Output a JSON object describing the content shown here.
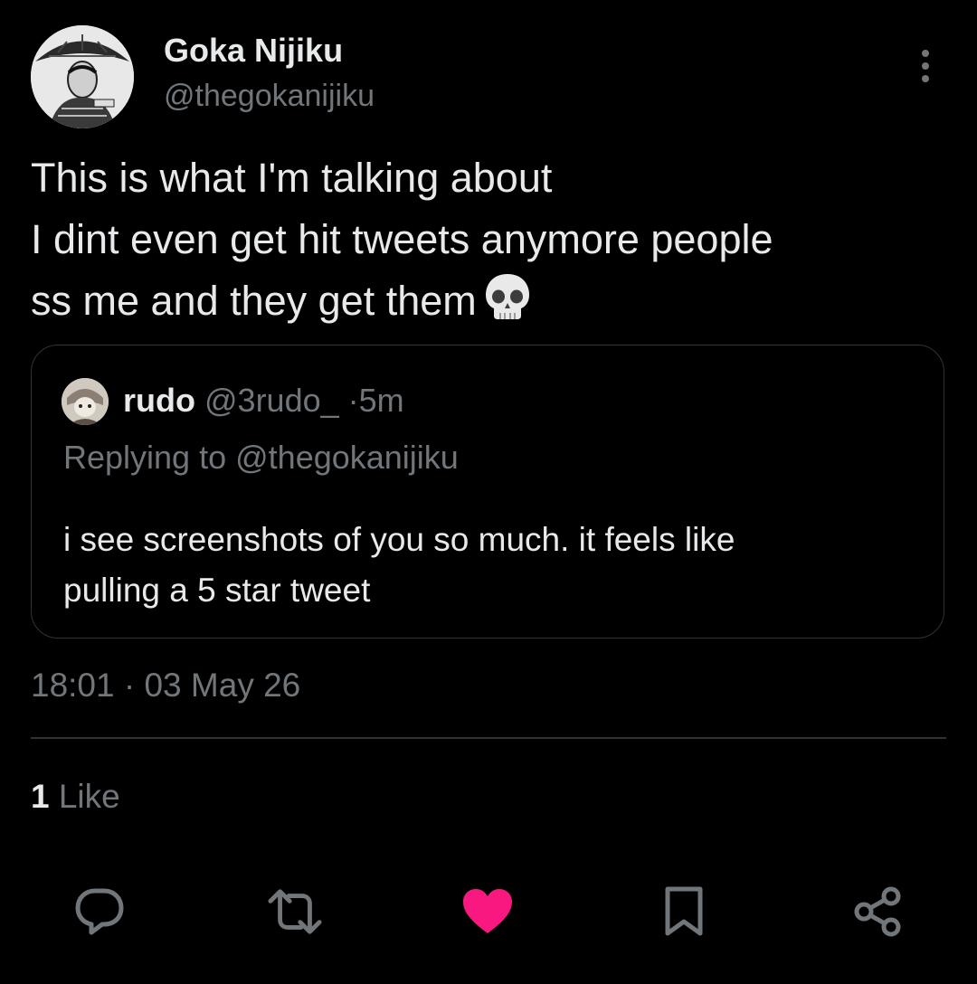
{
  "author": {
    "display_name": "Goka Nijiku",
    "handle": "@thegokanijiku",
    "avatar": "manga-character-avatar"
  },
  "tweet": {
    "text_lines": [
      "This is what I'm talking about",
      "I dint even get hit tweets anymore people",
      "ss me and they get them"
    ],
    "emoji": "skull-emoji"
  },
  "quote": {
    "display_name": "rudo",
    "handle": "@3rudo_",
    "separator": "·",
    "time": "5m",
    "replying_prefix": "Replying to",
    "replying_to": "@thegokanijiku",
    "text_lines": [
      "i see screenshots of you so much. it feels like",
      "pulling a 5 star tweet"
    ],
    "avatar": "anime-character-avatar"
  },
  "meta": {
    "time": "18:01",
    "separator": "·",
    "date": "03 May 26",
    "like_count": "1",
    "like_label": "Like"
  },
  "actions": {
    "reply_icon": "reply-icon",
    "retweet_icon": "retweet-icon",
    "like_icon": "heart-icon",
    "bookmark_icon": "bookmark-icon",
    "share_icon": "share-icon"
  },
  "colors": {
    "background": "#000000",
    "text_primary": "#e7e9ea",
    "text_secondary": "#71767b",
    "border": "#2f3336",
    "like_active": "#f91880"
  }
}
